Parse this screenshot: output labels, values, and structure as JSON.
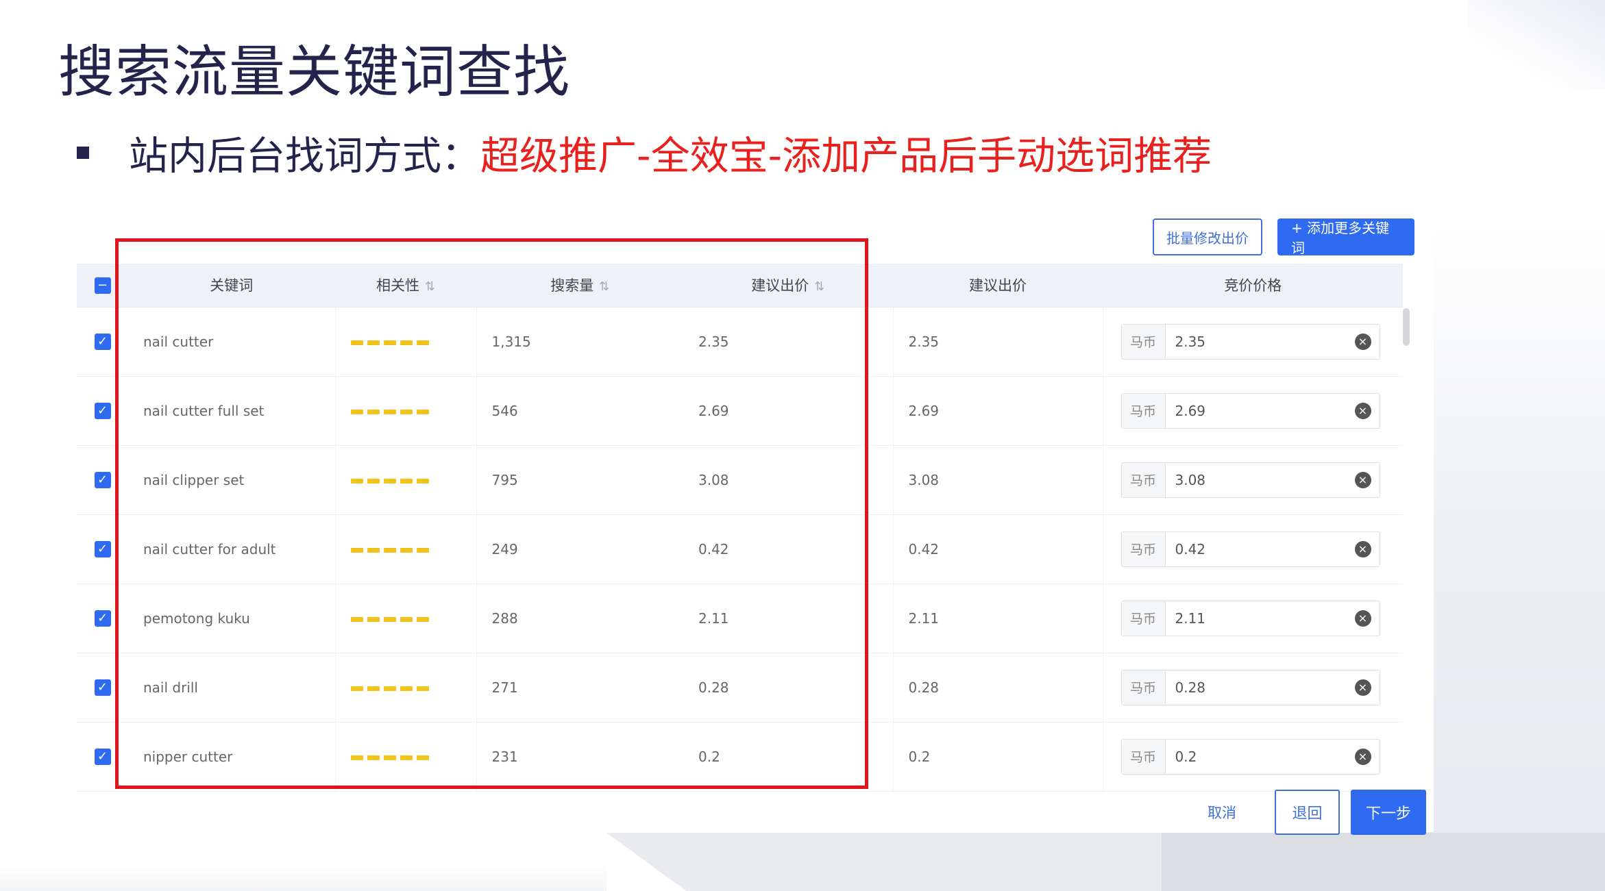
{
  "slide": {
    "title": "搜索流量关键词查找",
    "bullet_prefix": "站内后台找词方式：",
    "bullet_highlight": "超级推广-全效宝-添加产品后手动选词推荐"
  },
  "toolbar": {
    "batch_edit_label": "批量修改出价",
    "add_keywords_label": "+ 添加更多关键词"
  },
  "table": {
    "headers": {
      "keyword": "关键词",
      "relevance": "相关性",
      "search_volume": "搜索量",
      "suggested_bid_sortable": "建议出价",
      "suggested_bid": "建议出价",
      "bid_price": "竞价价格"
    },
    "sort_icon": "⇅",
    "currency_prefix": "马币",
    "rows": [
      {
        "keyword": "nail cutter",
        "relevance": 5,
        "search_volume": "1,315",
        "suggested_bid": "2.35",
        "suggested_bid2": "2.35",
        "bid": "2.35"
      },
      {
        "keyword": "nail cutter full set",
        "relevance": 5,
        "search_volume": "546",
        "suggested_bid": "2.69",
        "suggested_bid2": "2.69",
        "bid": "2.69"
      },
      {
        "keyword": "nail clipper set",
        "relevance": 5,
        "search_volume": "795",
        "suggested_bid": "3.08",
        "suggested_bid2": "3.08",
        "bid": "3.08"
      },
      {
        "keyword": "nail cutter for adult",
        "relevance": 5,
        "search_volume": "249",
        "suggested_bid": "0.42",
        "suggested_bid2": "0.42",
        "bid": "0.42"
      },
      {
        "keyword": "pemotong kuku",
        "relevance": 5,
        "search_volume": "288",
        "suggested_bid": "2.11",
        "suggested_bid2": "2.11",
        "bid": "2.11"
      },
      {
        "keyword": "nail drill",
        "relevance": 5,
        "search_volume": "271",
        "suggested_bid": "0.28",
        "suggested_bid2": "0.28",
        "bid": "0.28"
      },
      {
        "keyword": "nipper cutter",
        "relevance": 5,
        "search_volume": "231",
        "suggested_bid": "0.2",
        "suggested_bid2": "0.2",
        "bid": "0.2"
      }
    ]
  },
  "footer": {
    "cancel_label": "取消",
    "back_label": "退回",
    "next_label": "下一步"
  },
  "colors": {
    "title": "#23234b",
    "highlight": "#e8211e",
    "primary": "#2f6bf0",
    "star": "#f2c31a",
    "frame": "#e0141a"
  }
}
